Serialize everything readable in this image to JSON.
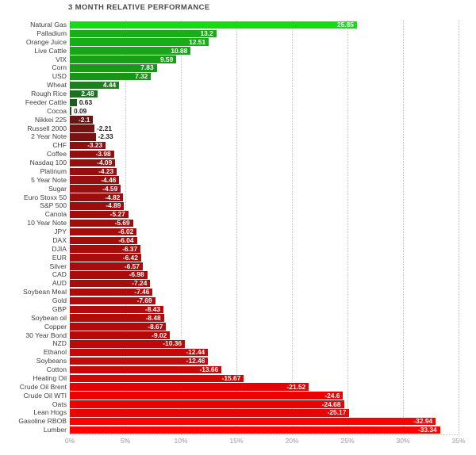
{
  "chart_data": {
    "type": "bar",
    "title": "3 MONTH RELATIVE PERFORMANCE",
    "xlabel": "",
    "ylabel": "",
    "orientation": "horizontal",
    "xlim": [
      0,
      35
    ],
    "xtick_labels": [
      "0%",
      "5%",
      "10%",
      "15%",
      "20%",
      "25%",
      "30%",
      "35%"
    ],
    "xticks": [
      0,
      5,
      10,
      15,
      20,
      25,
      30,
      35
    ],
    "grid": true,
    "grid_axis": "x",
    "legend": "none",
    "note": "Bar length encodes absolute value of the percentage; sign is encoded by color (green = positive, red = negative).",
    "colors": {
      "positive_max": "#12DD12",
      "positive_min": "#1E4D1E",
      "negative_max": "#FF0000",
      "negative_min": "#6B1414",
      "gridline": "#c9c9c9",
      "title": "#4a4a4a",
      "tick": "#9b9b9b",
      "label": "#3f3f3f"
    },
    "categories": [
      "Natural Gas",
      "Palladium",
      "Orange Juice",
      "Live Cattle",
      "VIX",
      "Corn",
      "USD",
      "Wheat",
      "Rough Rice",
      "Feeder Cattle",
      "Cocoa",
      "Nikkei 225",
      "Russell 2000",
      "2 Year Note",
      "CHF",
      "Coffee",
      "Nasdaq 100",
      "Platinum",
      "5 Year Note",
      "Sugar",
      "Euro Stoxx 50",
      "S&P 500",
      "Canola",
      "10 Year Note",
      "JPY",
      "DAX",
      "DJIA",
      "EUR",
      "Silver",
      "CAD",
      "AUD",
      "Soybean Meal",
      "Gold",
      "GBP",
      "Soybean oil",
      "Copper",
      "30 Year Bond",
      "NZD",
      "Ethanol",
      "Soybeans",
      "Cotton",
      "Heating Oil",
      "Crude Oil Brent",
      "Crude Oil WTI",
      "Oats",
      "Lean Hogs",
      "Gasoline RBOB",
      "Lumber"
    ],
    "values": [
      25.85,
      13.2,
      12.51,
      10.88,
      9.59,
      7.83,
      7.32,
      4.44,
      2.48,
      0.63,
      0.09,
      -2.1,
      -2.21,
      -2.33,
      -3.23,
      -3.98,
      -4.09,
      -4.23,
      -4.46,
      -4.59,
      -4.82,
      -4.89,
      -5.27,
      -5.69,
      -6.02,
      -6.04,
      -6.37,
      -6.42,
      -6.57,
      -6.98,
      -7.24,
      -7.46,
      -7.69,
      -8.43,
      -8.48,
      -8.67,
      -9.02,
      -10.36,
      -12.44,
      -12.46,
      -13.66,
      -15.67,
      -21.52,
      -24.6,
      -24.68,
      -25.17,
      -32.94,
      -33.34
    ],
    "value_labels": [
      "25.85",
      "13.2",
      "12.51",
      "10.88",
      "9.59",
      "7.83",
      "7.32",
      "4.44",
      "2.48",
      "0.63",
      "0.09",
      "-2.1",
      "-2.21",
      "-2.33",
      "-3.23",
      "-3.98",
      "-4.09",
      "-4.23",
      "-4.46",
      "-4.59",
      "-4.82",
      "-4.89",
      "-5.27",
      "-5.69",
      "-6.02",
      "-6.04",
      "-6.37",
      "-6.42",
      "-6.57",
      "-6.98",
      "-7.24",
      "-7.46",
      "-7.69",
      "-8.43",
      "-8.48",
      "-8.67",
      "-9.02",
      "-10.36",
      "-12.44",
      "-12.46",
      "-13.66",
      "-15.67",
      "-21.52",
      "-24.6",
      "-24.68",
      "-25.17",
      "-32.94",
      "-33.34"
    ]
  }
}
